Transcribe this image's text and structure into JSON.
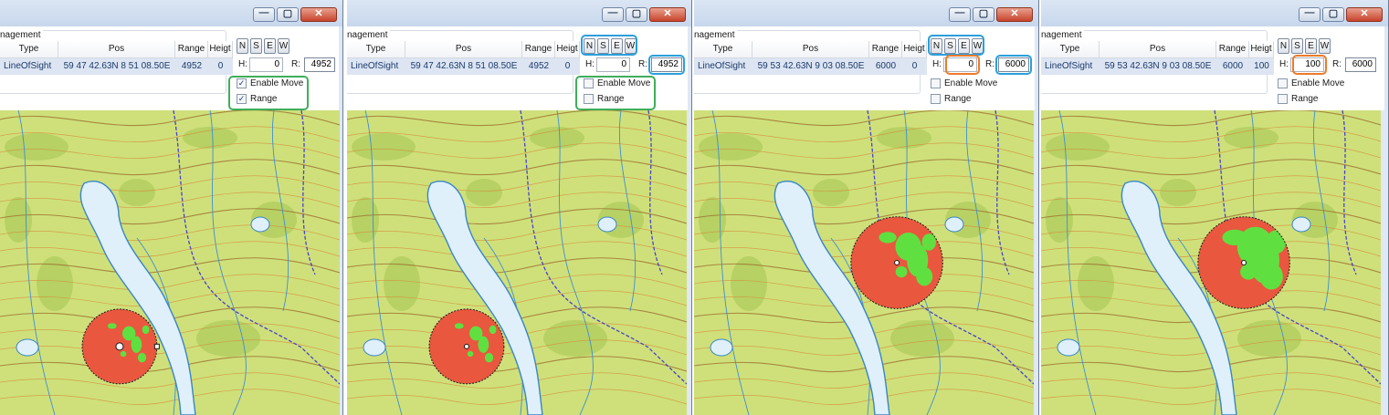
{
  "panels": [
    {
      "window": {
        "minimize_glyph": "—",
        "maximize_glyph": "▢",
        "close_glyph": "✕"
      },
      "group_label": "nagement",
      "columns": [
        "Type",
        "Pos",
        "Range",
        "Heigt"
      ],
      "row": {
        "type": "LineOfSight",
        "pos": "59 47 42.63N 8 51 08.50E",
        "range": "4952",
        "height": "0"
      },
      "compass": [
        "N",
        "S",
        "E",
        "W"
      ],
      "h_label": "H:",
      "h_value": "0",
      "r_label": "R:",
      "r_value": "4952",
      "enable_move": {
        "label": "Enable Move",
        "checked": true
      },
      "range_check": {
        "label": "Range",
        "checked": true
      },
      "highlights": [
        "green-checkboxes"
      ],
      "circle": {
        "center": [
          0.352,
          0.775
        ],
        "radius_share": 0.11,
        "green_share": 0.2
      }
    },
    {
      "window": {
        "minimize_glyph": "—",
        "maximize_glyph": "▢",
        "close_glyph": "✕"
      },
      "group_label": "nagement",
      "columns": [
        "Type",
        "Pos",
        "Range",
        "Heigt"
      ],
      "row": {
        "type": "LineOfSight",
        "pos": "59 47 42.63N 8 51 08.50E",
        "range": "4952",
        "height": "0"
      },
      "compass": [
        "N",
        "S",
        "E",
        "W"
      ],
      "h_label": "H:",
      "h_value": "0",
      "r_label": "R:",
      "r_value": "4952",
      "enable_move": {
        "label": "Enable Move",
        "checked": false
      },
      "range_check": {
        "label": "Range",
        "checked": false
      },
      "highlights": [
        "blue-compass",
        "blue-range",
        "green-checkboxes"
      ],
      "circle": {
        "center": [
          0.352,
          0.775
        ],
        "radius_share": 0.11,
        "green_share": 0.2
      }
    },
    {
      "window": {
        "minimize_glyph": "—",
        "maximize_glyph": "▢",
        "close_glyph": "✕"
      },
      "group_label": "nagement",
      "columns": [
        "Type",
        "Pos",
        "Range",
        "Heigt"
      ],
      "row": {
        "type": "LineOfSight",
        "pos": "59 53 42.63N 9 03 08.50E",
        "range": "6000",
        "height": "0"
      },
      "compass": [
        "N",
        "S",
        "E",
        "W"
      ],
      "h_label": "H:",
      "h_value": "0",
      "r_label": "R:",
      "r_value": "6000",
      "enable_move": {
        "label": "Enable Move",
        "checked": false
      },
      "range_check": {
        "label": "Range",
        "checked": false
      },
      "highlights": [
        "blue-compass",
        "orange-height",
        "blue-range"
      ],
      "circle": {
        "center": [
          0.597,
          0.5
        ],
        "radius_share": 0.135,
        "green_share": 0.32
      }
    },
    {
      "window": {
        "minimize_glyph": "—",
        "maximize_glyph": "▢",
        "close_glyph": "✕"
      },
      "group_label": "nagement",
      "columns": [
        "Type",
        "Pos",
        "Range",
        "Heigt"
      ],
      "row": {
        "type": "LineOfSight",
        "pos": "59 53 42.63N 9 03 08.50E",
        "range": "6000",
        "height": "100"
      },
      "compass": [
        "N",
        "S",
        "E",
        "W"
      ],
      "h_label": "H:",
      "h_value": "100",
      "r_label": "R:",
      "r_value": "6000",
      "enable_move": {
        "label": "Enable Move",
        "checked": false
      },
      "range_check": {
        "label": "Range",
        "checked": false
      },
      "highlights": [
        "orange-height"
      ],
      "circle": {
        "center": [
          0.597,
          0.5
        ],
        "radius_share": 0.135,
        "green_share": 0.45
      }
    }
  ],
  "colors": {
    "map_base": "#cfe07a",
    "map_dark": "#b4cf62",
    "forest_line": "#9a6a2e",
    "contour": "#d48b3a",
    "water": "#dff0fa",
    "water_edge": "#3a86c4",
    "stream": "#3d8fd0",
    "road": "#4a42c8",
    "los_red": "#e9573f",
    "los_green": "#5fe040",
    "highlight_green": "#3fae5a",
    "highlight_blue": "#2a9fdc",
    "highlight_orange": "#ee7a2a"
  },
  "icons": {
    "compass": "direction-buttons",
    "checkbox_checked": "check-icon"
  }
}
